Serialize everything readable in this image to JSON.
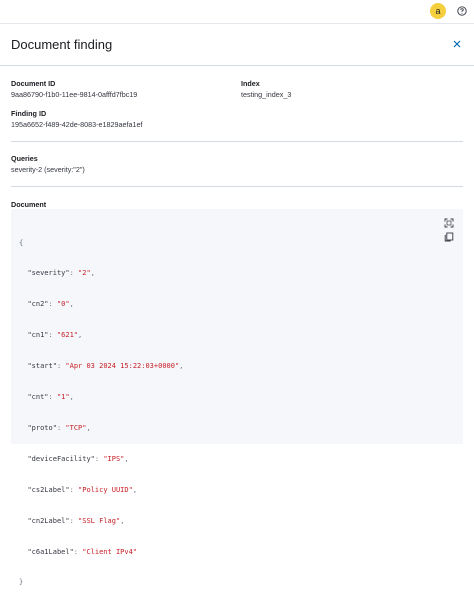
{
  "topbar": {
    "avatar_initial": "a",
    "avatar_color": "#f4d03f",
    "help_icon": "help-circle-icon"
  },
  "flyout": {
    "title": "Document finding",
    "close_icon": "close-icon"
  },
  "fields": {
    "document_id_label": "Document ID",
    "document_id_value": "9aa86790-f1b0-11ee-9814-0afffd7fbc19",
    "index_label": "Index",
    "index_value": "testing_index_3",
    "finding_id_label": "Finding ID",
    "finding_id_value": "195a6652-f489-42de-8083-e1829aefa1ef",
    "queries_label": "Queries",
    "queries_value": "severity-2 (severity:\"2\")",
    "document_label": "Document"
  },
  "document": {
    "open_brace": "{",
    "close_brace": "}",
    "entries": [
      {
        "key": "\"severity\"",
        "value": "\"2\"",
        "comma": ","
      },
      {
        "key": "\"cn2\"",
        "value": "\"0\"",
        "comma": ","
      },
      {
        "key": "\"cn1\"",
        "value": "\"621\"",
        "comma": ","
      },
      {
        "key": "\"start\"",
        "value": "\"Apr 03 2024 15:22:03+0000\"",
        "comma": ","
      },
      {
        "key": "\"cnt\"",
        "value": "\"1\"",
        "comma": ","
      },
      {
        "key": "\"proto\"",
        "value": "\"TCP\"",
        "comma": ","
      },
      {
        "key": "\"deviceFacility\"",
        "value": "\"IPS\"",
        "comma": ","
      },
      {
        "key": "\"cs2Label\"",
        "value": "\"Policy UUID\"",
        "comma": ","
      },
      {
        "key": "\"cn2Label\"",
        "value": "\"SSL Flag\"",
        "comma": ","
      },
      {
        "key": "\"c6a1Label\"",
        "value": "\"Client IPv4\"",
        "comma": ""
      }
    ],
    "fullscreen_icon": "fullscreen-icon",
    "copy_icon": "copy-icon"
  }
}
